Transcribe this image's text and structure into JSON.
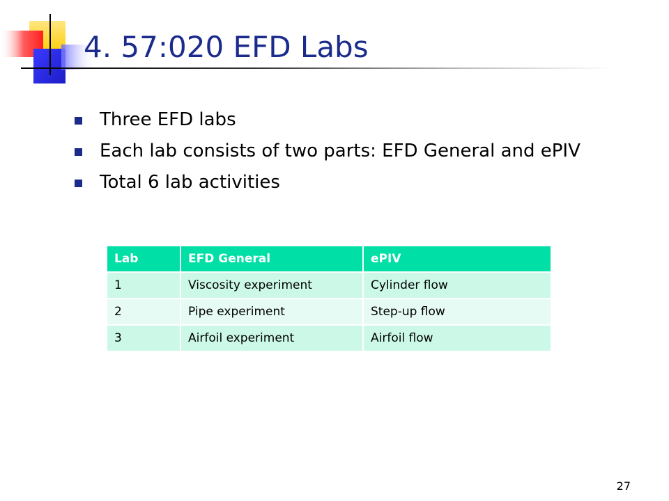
{
  "slide": {
    "title": "4. 57:020 EFD Labs",
    "bullets": [
      "Three EFD labs",
      "Each lab consists of two parts: EFD General and ePIV",
      "Total 6 lab activities"
    ],
    "table": {
      "headers": [
        "Lab",
        "EFD General",
        "ePIV"
      ],
      "rows": [
        [
          "1",
          "Viscosity experiment",
          "Cylinder flow"
        ],
        [
          "2",
          "Pipe experiment",
          "Step-up flow"
        ],
        [
          "3",
          "Airfoil experiment",
          "Airfoil flow"
        ]
      ]
    },
    "page_number": "27"
  },
  "colors": {
    "title": "#1a2b8c",
    "bullet_marker": "#1a2b8c",
    "table_header": "#00e0a6",
    "table_row_odd": "#ccf8e8",
    "table_row_even": "#e6fbf3",
    "deco_yellow": "#ffd21f",
    "deco_red": "#ff2a2a",
    "deco_blue": "#2a2aff"
  }
}
